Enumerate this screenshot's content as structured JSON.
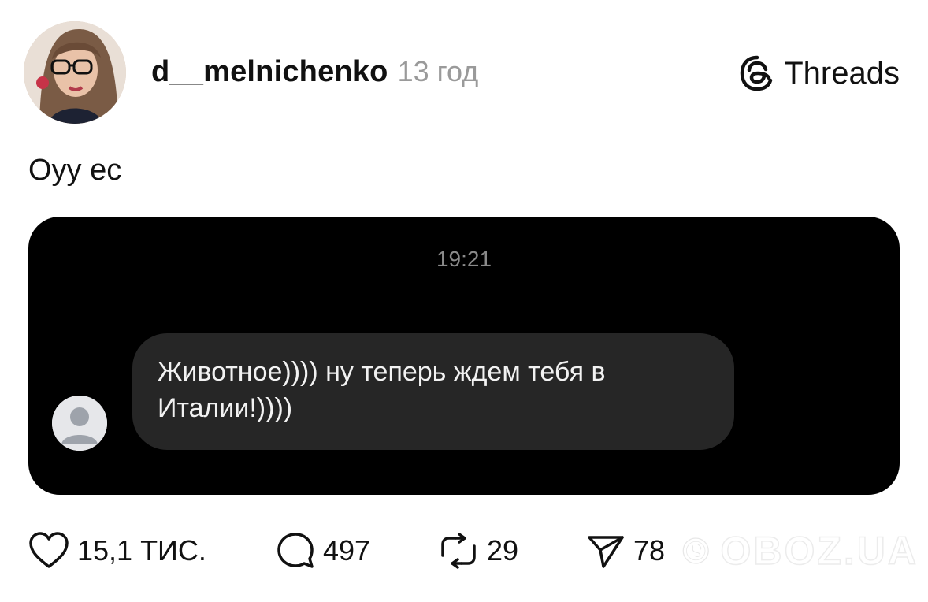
{
  "post": {
    "username": "d__melnichenko",
    "time_ago": "13 год",
    "text": "Оуу ес"
  },
  "brand": {
    "label": "Threads",
    "icon": "threads-logo-icon"
  },
  "chat_screenshot": {
    "timestamp": "19:21",
    "message": "Животное)))) ну теперь ждем тебя в Италии!))))",
    "bubble_color": "#262626",
    "background_color": "#000000"
  },
  "actions": {
    "likes": "15,1 ТИС.",
    "comments": "497",
    "reposts": "29",
    "shares": "78"
  },
  "watermark": {
    "text": "OBOZ.UA"
  }
}
